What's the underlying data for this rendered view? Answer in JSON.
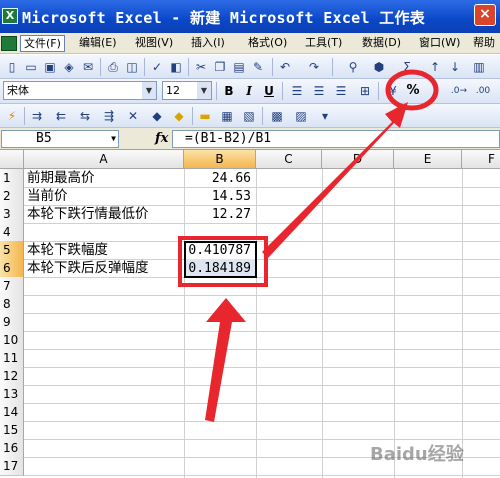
{
  "window": {
    "title": "Microsoft Excel - 新建 Microsoft Excel 工作表",
    "app_icon_glyph": "X"
  },
  "menu": {
    "items": [
      "文件(F)",
      "编辑(E)",
      "视图(V)",
      "插入(I)",
      "格式(O)",
      "工具(T)",
      "数据(D)",
      "窗口(W)",
      "帮助"
    ],
    "active_index": 0
  },
  "format_toolbar": {
    "font_name": "宋体",
    "font_size": "12",
    "bold": "B",
    "italic": "I",
    "underline": "U",
    "percent_button": "%",
    "comma_button": ","
  },
  "formula_bar": {
    "name_box": "B5",
    "fx": "fx",
    "formula": "=(B1-B2)/B1"
  },
  "sheet": {
    "columns": [
      "A",
      "B",
      "C",
      "D",
      "E",
      "F"
    ],
    "selected_column": "B",
    "rows": [
      "1",
      "2",
      "3",
      "4",
      "5",
      "6",
      "7",
      "8",
      "9",
      "10",
      "11",
      "12",
      "13",
      "14",
      "15",
      "16",
      "17"
    ],
    "selected_rows": [
      "5",
      "6"
    ],
    "cells": [
      {
        "row": "1",
        "a": "前期最高价",
        "b": "24.66"
      },
      {
        "row": "2",
        "a": "当前价",
        "b": "14.53"
      },
      {
        "row": "3",
        "a": "本轮下跌行情最低价",
        "b": "12.27"
      },
      {
        "row": "4",
        "a": "",
        "b": ""
      },
      {
        "row": "5",
        "a": "本轮下跌幅度",
        "b": "0.410787"
      },
      {
        "row": "6",
        "a": "本轮下跌后反弹幅度",
        "b": "0.184189"
      }
    ]
  },
  "annotation": {
    "color": "#e8262d",
    "watermark": "Baidu经验"
  }
}
